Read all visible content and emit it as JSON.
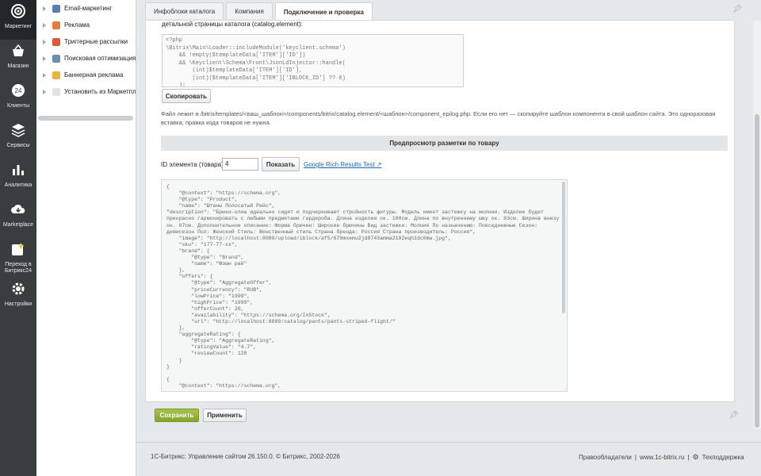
{
  "rail": {
    "items": [
      {
        "label": "Маркетинг",
        "icon": "target-icon",
        "active": true
      },
      {
        "label": "Магазин",
        "icon": "basket-icon"
      },
      {
        "label": "Клиенты",
        "icon": "crm-icon"
      },
      {
        "label": "Сервисы",
        "icon": "layers-icon"
      },
      {
        "label": "Аналитика",
        "icon": "bar-chart-icon"
      },
      {
        "label": "Marketplace",
        "icon": "cloud-download-icon"
      },
      {
        "label": "Переход в Битрикс24",
        "icon": "bitrix24-icon"
      },
      {
        "label": "Настройки",
        "icon": "gear-icon"
      }
    ]
  },
  "submenu": {
    "items": [
      {
        "label": "Email-маркетинг",
        "color": "#5a7fa8"
      },
      {
        "label": "Реклама",
        "color": "#e07e3c"
      },
      {
        "label": "Триггерные рассылки",
        "color": "#d95b3c"
      },
      {
        "label": "Поисковая оптимизация",
        "color": "#6c8fb1"
      },
      {
        "label": "Баннерная реклама",
        "color": "#e5b53f"
      },
      {
        "label": "Установить из Маркетплейс",
        "color": "#e0e4e7"
      }
    ]
  },
  "tabs": [
    {
      "label": "Инфоблоки каталога",
      "active": false
    },
    {
      "label": "Компания",
      "active": false
    },
    {
      "label": "Подключение и проверка",
      "active": true
    }
  ],
  "connect": {
    "intro": "детальной страницы каталога (catalog.element):",
    "code_lines": [
      "<?php",
      "\\Bitrix\\Main\\Loader::includeModule('keyclient.schema')",
      "    && !empty($templateData['ITEM']['ID'])",
      "    && \\Keyclient\\Schema\\Front\\JsonLdInjector::handle(",
      "        (int)$templateData['ITEM']['ID'],",
      "        (int)($templateData['ITEM']['IBLOCK_ID'] ?? 0)",
      "    );"
    ],
    "copy_button": "Скопировать",
    "note": "Файл лежит в /bitrix/templates/<ваш_шаблон>/components/bitrix/catalog.element/<шаблон>/component_epilog.php. Если его нет — скопируйте шаблон компонента в свой шаблон сайта. Это одноразовая вставка; правка кода товаров не нужна."
  },
  "preview": {
    "title": "Предпросмотр разметки по товару",
    "id_label": "ID элемента (товара):",
    "id_value": "4",
    "show_button": "Показать",
    "google_link": "Google Rich Results Test ↗",
    "json_lines": [
      "{",
      "    \"@context\": \"https://schema.org\",",
      "    \"@type\": \"Product\",",
      "    \"name\": \"Штаны Полосатый Рейс\","
    ],
    "description_line": "    \"description\": \"Брюки-клеш идеально сидят и подчеркивают стройность фигуры. Модель имеет застежку на молнии. Изделие будет прекрасно гармонировать с любыми предметами гардероба. Длина изделия ок. 100см. Длина по внутреннему шву ок. 83см. Ширина внизу ок. 87см. Дополнительное описание: Форма брючин: Широкие брючины Вид застежки: Молния По назначению: Повседневные Сезон: демисезон Пол: Женский Стиль: Женственный стиль Страна бренда: Россия Страна производитель: Россия\",",
    "json_lines_2": [
      "    \"image\": \"http://localhost:8089/upload/iblock/af5/670mxemu2jd8743amma2192eqh1dc0mw.jpg\",",
      "    \"sku\": \"177-77-xx\",",
      "    \"brand\": {",
      "        \"@type\": \"Brand\",",
      "        \"name\": \"Фэшн рай\"",
      "    },",
      "    \"offers\": {",
      "        \"@type\": \"AggregateOffer\",",
      "        \"priceCurrency\": \"RUB\",",
      "        \"lowPrice\": \"1999\",",
      "        \"highPrice\": \"1999\",",
      "        \"offerCount\": 20,",
      "        \"availability\": \"https://schema.org/InStock\",",
      "        \"url\": \"http://localhost:8089/catalog/pants/pants-striped-flight/\"",
      "    },",
      "    \"aggregateRating\": {",
      "        \"@type\": \"AggregateRating\",",
      "        \"ratingValue\": \"4.7\",",
      "        \"reviewCount\": 128",
      "    }",
      "}",
      "",
      "{",
      "    \"@context\": \"https://schema.org\","
    ]
  },
  "actions": {
    "save": "Сохранить",
    "apply": "Применить"
  },
  "footer": {
    "copyright": "1С-Битрикс: Управление сайтом 26.150.0. © Битрикс, 2002-2026",
    "rights": "Правообладатели",
    "site": "www.1c-bitrix.ru",
    "support": "Техподдержка",
    "separator": "|"
  }
}
